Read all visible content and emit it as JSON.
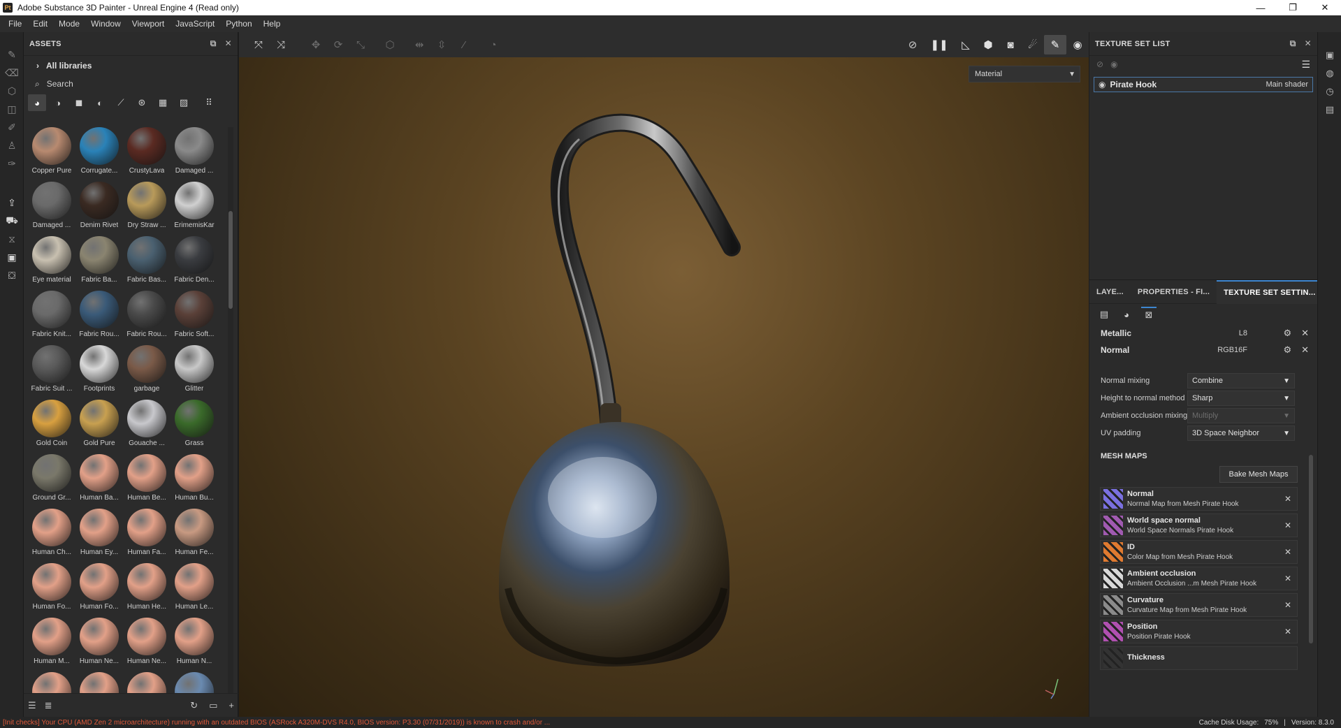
{
  "window": {
    "title": "Adobe Substance 3D Painter - Unreal Engine 4 (Read only)",
    "logo": "Pt",
    "controls": [
      "—",
      "❐",
      "✕"
    ]
  },
  "menu": [
    "File",
    "Edit",
    "Mode",
    "Window",
    "Viewport",
    "JavaScript",
    "Python",
    "Help"
  ],
  "assets": {
    "title": "ASSETS",
    "libraries": "All libraries",
    "search_placeholder": "Search",
    "items": [
      {
        "label": "Copper Pure",
        "color": "#b88a70"
      },
      {
        "label": "Corrugate...",
        "color": "#2a82b8"
      },
      {
        "label": "CrustyLava",
        "color": "#5a2a22"
      },
      {
        "label": "Damaged ...",
        "color": "#8a8a8a"
      },
      {
        "label": "Damaged ...",
        "color": "#6a6a6a"
      },
      {
        "label": "Denim Rivet",
        "color": "#3a2a22"
      },
      {
        "label": "Dry Straw ...",
        "color": "#b89a5a"
      },
      {
        "label": "ErimemisKar",
        "color": "#d0d0d0"
      },
      {
        "label": "Eye material",
        "color": "#c8c0b0"
      },
      {
        "label": "Fabric Ba...",
        "color": "#8a8470"
      },
      {
        "label": "Fabric Bas...",
        "color": "#4a6070"
      },
      {
        "label": "Fabric Den...",
        "color": "#3a3c40"
      },
      {
        "label": "Fabric Knit...",
        "color": "#6a6a6a"
      },
      {
        "label": "Fabric Rou...",
        "color": "#3a5a78"
      },
      {
        "label": "Fabric Rou...",
        "color": "#4a4a4a"
      },
      {
        "label": "Fabric Soft...",
        "color": "#5a4038"
      },
      {
        "label": "Fabric Suit ...",
        "color": "#5a5a5a"
      },
      {
        "label": "Footprints",
        "color": "#d8d8d8"
      },
      {
        "label": "garbage",
        "color": "#7a5a48"
      },
      {
        "label": "Glitter",
        "color": "#c8c8c8"
      },
      {
        "label": "Gold Coin",
        "color": "#d8a040"
      },
      {
        "label": "Gold Pure",
        "color": "#c8a050"
      },
      {
        "label": "Gouache ...",
        "color": "#c8c8cc"
      },
      {
        "label": "Grass",
        "color": "#3a6a2a"
      },
      {
        "label": "Ground Gr...",
        "color": "#7a786a"
      },
      {
        "label": "Human Ba...",
        "color": "#e2a088"
      },
      {
        "label": "Human Be...",
        "color": "#e2a088"
      },
      {
        "label": "Human Bu...",
        "color": "#e2a088"
      },
      {
        "label": "Human Ch...",
        "color": "#e2a088"
      },
      {
        "label": "Human Ey...",
        "color": "#e2a088"
      },
      {
        "label": "Human Fa...",
        "color": "#e2a088"
      },
      {
        "label": "Human Fe...",
        "color": "#c89a82"
      },
      {
        "label": "Human Fo...",
        "color": "#e2a088"
      },
      {
        "label": "Human Fo...",
        "color": "#e2a088"
      },
      {
        "label": "Human He...",
        "color": "#e2a088"
      },
      {
        "label": "Human Le...",
        "color": "#e2a088"
      },
      {
        "label": "Human M...",
        "color": "#e2a088"
      },
      {
        "label": "Human Ne...",
        "color": "#e2a088"
      },
      {
        "label": "Human Ne...",
        "color": "#e2a088"
      },
      {
        "label": "Human N...",
        "color": "#e2a088"
      },
      {
        "label": "",
        "color": "#e2a088"
      },
      {
        "label": "",
        "color": "#e2a088"
      },
      {
        "label": "",
        "color": "#e2a088"
      },
      {
        "label": "",
        "color": "#6a8ab0"
      }
    ]
  },
  "viewport": {
    "material_mode": "Material"
  },
  "texture_set_list": {
    "title": "TEXTURE SET LIST",
    "rows": [
      {
        "name": "Pirate Hook",
        "shader": "Main shader"
      }
    ]
  },
  "texture_set_settings": {
    "tabs": [
      "LAYE...",
      "PROPERTIES - FI...",
      "TEXTURE SET SETTIN..."
    ],
    "channels": [
      {
        "name": "Metallic",
        "format": "L8"
      },
      {
        "name": "Normal",
        "format": "RGB16F"
      }
    ],
    "properties": [
      {
        "label": "Normal mixing",
        "value": "Combine",
        "disabled": false
      },
      {
        "label": "Height to normal method",
        "value": "Sharp",
        "disabled": false
      },
      {
        "label": "Ambient occlusion mixing",
        "value": "Multiply",
        "disabled": true
      },
      {
        "label": "UV padding",
        "value": "3D Space Neighbor",
        "disabled": false
      }
    ],
    "mesh_maps_title": "MESH MAPS",
    "bake_button": "Bake Mesh Maps",
    "mesh_maps": [
      {
        "name": "Normal",
        "desc": "Normal Map from Mesh Pirate Hook",
        "color": "#7a70e0"
      },
      {
        "name": "World space normal",
        "desc": "World Space Normals Pirate Hook",
        "color": "#a05ab0"
      },
      {
        "name": "ID",
        "desc": "Color Map from Mesh Pirate Hook",
        "color": "#e07a30"
      },
      {
        "name": "Ambient occlusion",
        "desc": "Ambient Occlusion ...m Mesh Pirate Hook",
        "color": "#d8d8d8"
      },
      {
        "name": "Curvature",
        "desc": "Curvature Map from Mesh Pirate Hook",
        "color": "#8a8a8a"
      },
      {
        "name": "Position",
        "desc": "Position Pirate Hook",
        "color": "#b050b0"
      },
      {
        "name": "Thickness",
        "desc": "",
        "color": "#333333"
      }
    ]
  },
  "status": {
    "message": "[Init checks] Your CPU (AMD Zen 2 microarchitecture) running with an outdated BIOS (ASRock A320M-DVS R4.0, BIOS version: P3.30 (07/31/2019)) is known to crash and/or ...",
    "cache": "Cache Disk Usage:",
    "cache_value": "75%",
    "version": "Version: 8.3.0"
  }
}
